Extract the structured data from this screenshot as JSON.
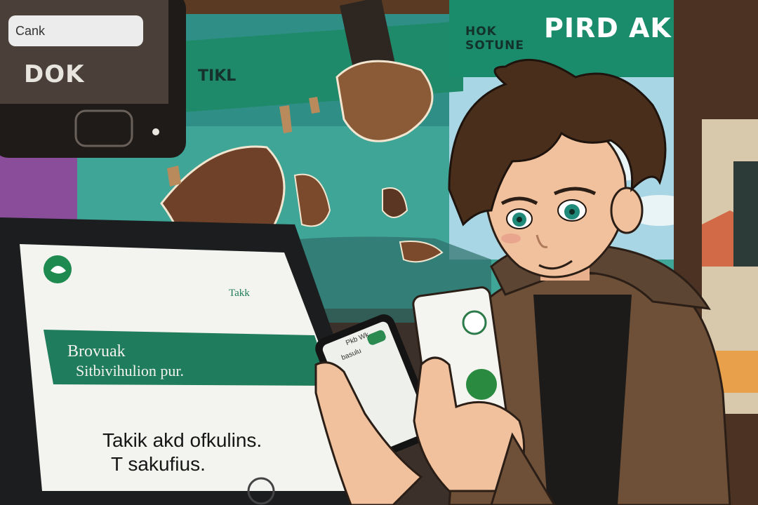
{
  "top_left_phone": {
    "search_text": "Cank",
    "title": "DOK"
  },
  "signs": {
    "left_label": "TIKL",
    "hok_line1": "HOK",
    "hok_line2": "SOTUNE",
    "brand": "PIRD AK"
  },
  "tablet": {
    "small_label": "Takk",
    "band_line1": "Brovuak",
    "band_line2": "Sitbivihulion pur.",
    "body_line1": "Takik akd ofkulins.",
    "body_line2": "T sakufius."
  },
  "front_phone": {
    "line1": "Pkb Wk",
    "line2": "basulu"
  },
  "colors": {
    "teal": "#1f8a6a",
    "sky": "#6fb8ac",
    "hair": "#4a2e1c",
    "jacket": "#6e5038"
  }
}
